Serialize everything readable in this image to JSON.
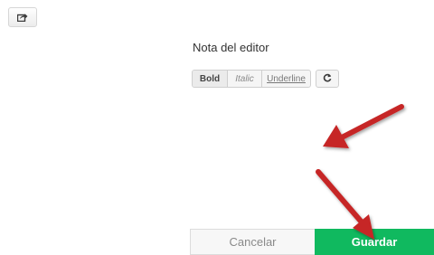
{
  "toolbar": {
    "share_icon": "share-square-icon"
  },
  "editor": {
    "title": "Nota del editor",
    "format_buttons": {
      "bold": "Bold",
      "italic": "Italic",
      "underline": "Underline"
    },
    "refresh_icon": "refresh-icon"
  },
  "footer": {
    "cancel_label": "Cancelar",
    "save_label": "Guardar"
  },
  "colors": {
    "save_button": "#10b95f",
    "annotation_arrow": "#c62828"
  }
}
